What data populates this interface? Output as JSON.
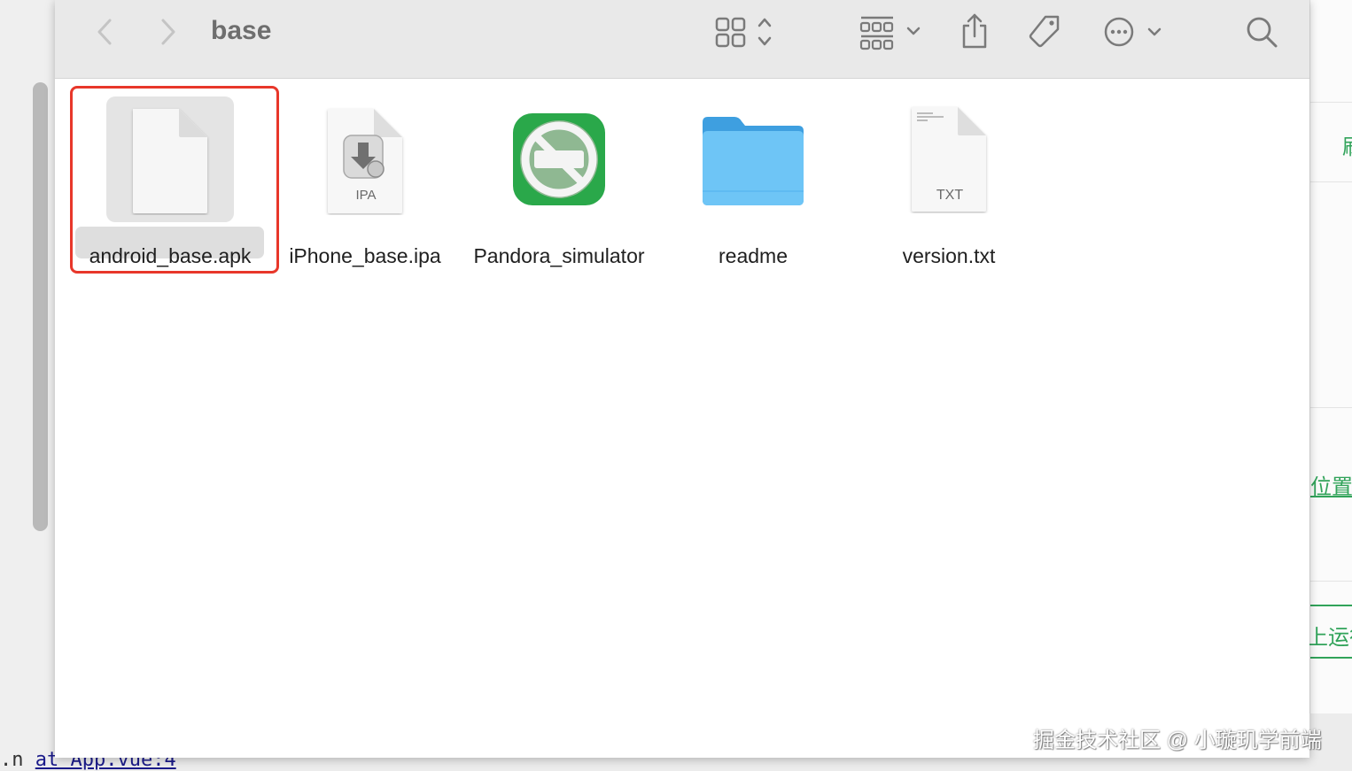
{
  "window": {
    "title": "base"
  },
  "toolbar": {
    "back_icon": "chevron-left-icon",
    "forward_icon": "chevron-right-icon",
    "view_icon": "icon-grid-view-icon",
    "group_icon": "group-by-icon",
    "share_icon": "share-icon",
    "tag_icon": "tag-icon",
    "more_icon": "ellipsis-circle-icon",
    "search_icon": "search-icon"
  },
  "files": [
    {
      "name": "android_base.apk",
      "type": "document",
      "selected": true
    },
    {
      "name": "iPhone_base.ipa",
      "type": "ipa",
      "badge": "IPA"
    },
    {
      "name": "Pandora_simulator",
      "type": "app"
    },
    {
      "name": "readme",
      "type": "folder"
    },
    {
      "name": "version.txt",
      "type": "text",
      "badge": "TXT"
    }
  ],
  "background": {
    "editor_bottom_prefix": ".n",
    "editor_bottom_link": "at App.vue:4",
    "right_text_1": "刷",
    "right_text_2": "位置",
    "right_text_3": "上运行"
  },
  "watermark": "掘金技术社区 @ 小璇玑学前端",
  "colors": {
    "selection_outline": "#e8372a",
    "folder_blue": "#5ab8f0",
    "app_green": "#2aa84a"
  }
}
